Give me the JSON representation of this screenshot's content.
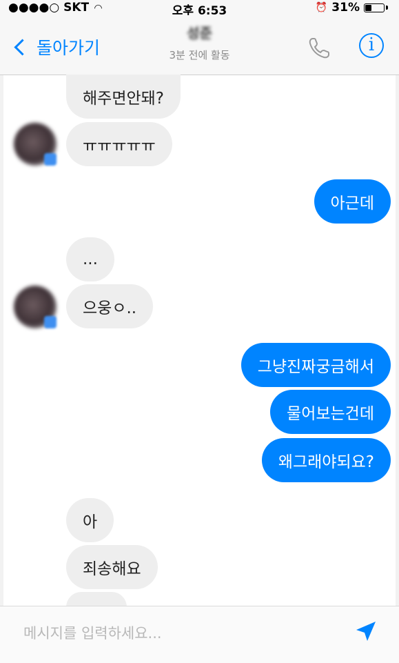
{
  "status_bar": {
    "carrier": "●●●●○ SKT",
    "time": "오후 6:53",
    "battery": "31%",
    "battery_level": 0.31
  },
  "header": {
    "back_label": "돌아가기",
    "contact_name": "성준",
    "contact_status": "3분 전에 활동"
  },
  "messages": [
    {
      "side": "in",
      "text": "해주면안돼?"
    },
    {
      "side": "in",
      "text": "ㅠㅠㅠㅠㅠ"
    },
    {
      "side": "out",
      "text": "아근데"
    },
    {
      "side": "in",
      "text": "..."
    },
    {
      "side": "in",
      "text": "으웅ㅇ.."
    },
    {
      "side": "out",
      "text": "그냥진짜궁금해서"
    },
    {
      "side": "out",
      "text": "물어보는건데"
    },
    {
      "side": "out",
      "text": "왜그래야되요?"
    },
    {
      "side": "in",
      "text": "아"
    },
    {
      "side": "in",
      "text": "죄송해요"
    }
  ],
  "composer": {
    "placeholder": "메시지를 입력하세요..."
  },
  "colors": {
    "accent": "#0084ff",
    "incoming_bubble": "#eeeeee",
    "outgoing_text": "#ffffff"
  }
}
